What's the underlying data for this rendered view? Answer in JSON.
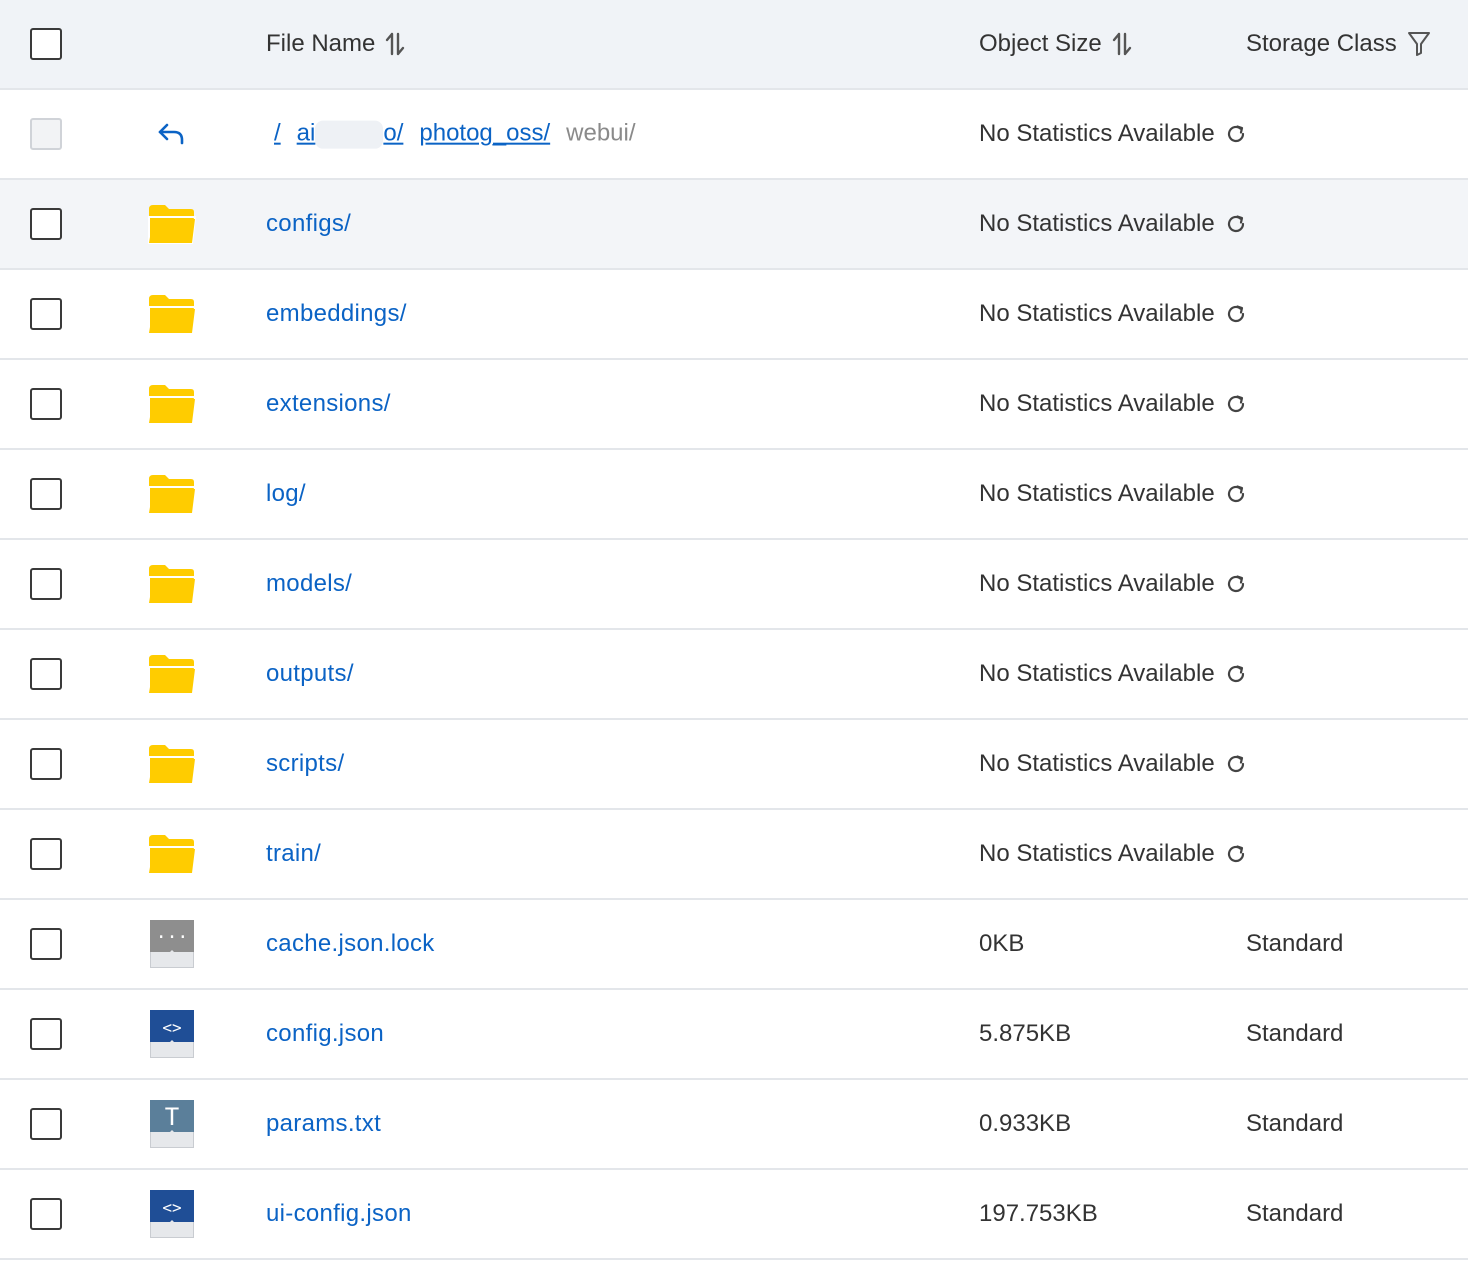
{
  "header": {
    "file_name": "File Name",
    "object_size": "Object Size",
    "storage_class": "Storage Class"
  },
  "breadcrumb": {
    "root": "/",
    "seg1_prefix": "ai",
    "seg1_suffix": "o/",
    "seg2": "photog_oss/",
    "current": "webui/",
    "stats": "No Statistics Available"
  },
  "rows": [
    {
      "name": "configs/",
      "kind": "folder",
      "size": "No Statistics Available",
      "storage_class": ""
    },
    {
      "name": "embeddings/",
      "kind": "folder",
      "size": "No Statistics Available",
      "storage_class": ""
    },
    {
      "name": "extensions/",
      "kind": "folder",
      "size": "No Statistics Available",
      "storage_class": ""
    },
    {
      "name": "log/",
      "kind": "folder",
      "size": "No Statistics Available",
      "storage_class": ""
    },
    {
      "name": "models/",
      "kind": "folder",
      "size": "No Statistics Available",
      "storage_class": ""
    },
    {
      "name": "outputs/",
      "kind": "folder",
      "size": "No Statistics Available",
      "storage_class": ""
    },
    {
      "name": "scripts/",
      "kind": "folder",
      "size": "No Statistics Available",
      "storage_class": ""
    },
    {
      "name": "train/",
      "kind": "folder",
      "size": "No Statistics Available",
      "storage_class": ""
    },
    {
      "name": "cache.json.lock",
      "kind": "generic-file",
      "size": "0KB",
      "storage_class": "Standard"
    },
    {
      "name": "config.json",
      "kind": "code-file",
      "size": "5.875KB",
      "storage_class": "Standard"
    },
    {
      "name": "params.txt",
      "kind": "text-file",
      "size": "0.933KB",
      "storage_class": "Standard"
    },
    {
      "name": "ui-config.json",
      "kind": "code-file",
      "size": "197.753KB",
      "storage_class": "Standard"
    }
  ],
  "icons": {
    "generic_glyph": "···",
    "code_glyph": "<>",
    "text_glyph": "T"
  },
  "colors": {
    "link": "#0b63c5",
    "folder": "#ffcc00",
    "header_bg": "#f0f3f7",
    "code_icon": "#1f4e96",
    "text_icon": "#5b7f9a",
    "generic_icon": "#8e8e8e"
  }
}
